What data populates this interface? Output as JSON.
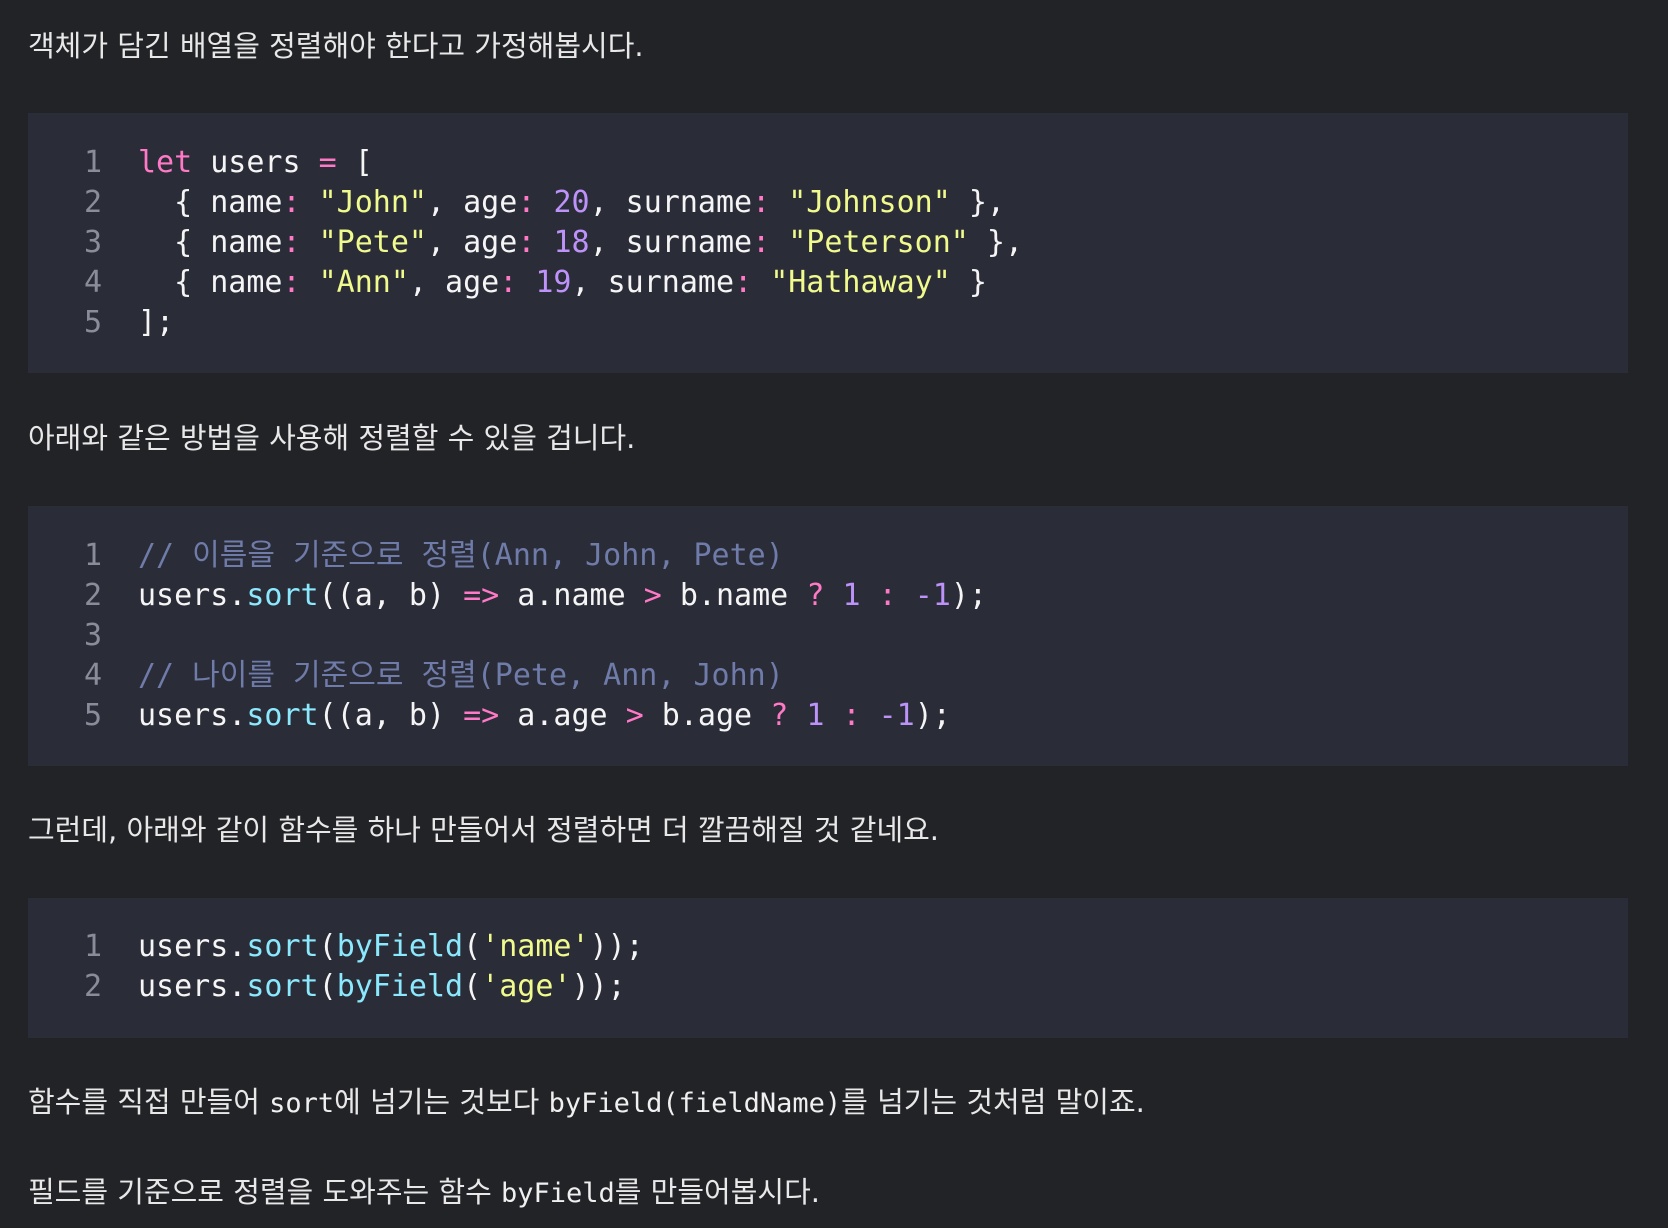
{
  "paragraphs": {
    "p1": "객체가 담긴 배열을 정렬해야 한다고 가정해봅시다.",
    "p2": "아래와 같은 방법을 사용해 정렬할 수 있을 겁니다.",
    "p3": "그런데, 아래와 같이 함수를 하나 만들어서 정렬하면 더 깔끔해질 것 같네요.",
    "p4_a": "함수를 직접 만들어 ",
    "p4_code1": "sort",
    "p4_b": "에 넘기는 것보다 ",
    "p4_code2": "byField(fieldName)",
    "p4_c": "를 넘기는 것처럼 말이죠.",
    "p5_a": "필드를 기준으로 정렬을 도와주는 함수 ",
    "p5_code": "byField",
    "p5_b": "를 만들어봅시다."
  },
  "code_blocks": [
    {
      "line_numbers": [
        "1",
        "2",
        "3",
        "4",
        "5"
      ],
      "lines": [
        [
          {
            "t": "let",
            "c": "kw"
          },
          {
            "t": " users ",
            "c": "pl"
          },
          {
            "t": "=",
            "c": "op"
          },
          {
            "t": " [",
            "c": "pl"
          }
        ],
        [
          {
            "t": "  { name",
            "c": "pl"
          },
          {
            "t": ":",
            "c": "op"
          },
          {
            "t": " ",
            "c": "pl"
          },
          {
            "t": "\"John\"",
            "c": "str"
          },
          {
            "t": ", age",
            "c": "pl"
          },
          {
            "t": ":",
            "c": "op"
          },
          {
            "t": " ",
            "c": "pl"
          },
          {
            "t": "20",
            "c": "num"
          },
          {
            "t": ", surname",
            "c": "pl"
          },
          {
            "t": ":",
            "c": "op"
          },
          {
            "t": " ",
            "c": "pl"
          },
          {
            "t": "\"Johnson\"",
            "c": "str"
          },
          {
            "t": " },",
            "c": "pl"
          }
        ],
        [
          {
            "t": "  { name",
            "c": "pl"
          },
          {
            "t": ":",
            "c": "op"
          },
          {
            "t": " ",
            "c": "pl"
          },
          {
            "t": "\"Pete\"",
            "c": "str"
          },
          {
            "t": ", age",
            "c": "pl"
          },
          {
            "t": ":",
            "c": "op"
          },
          {
            "t": " ",
            "c": "pl"
          },
          {
            "t": "18",
            "c": "num"
          },
          {
            "t": ", surname",
            "c": "pl"
          },
          {
            "t": ":",
            "c": "op"
          },
          {
            "t": " ",
            "c": "pl"
          },
          {
            "t": "\"Peterson\"",
            "c": "str"
          },
          {
            "t": " },",
            "c": "pl"
          }
        ],
        [
          {
            "t": "  { name",
            "c": "pl"
          },
          {
            "t": ":",
            "c": "op"
          },
          {
            "t": " ",
            "c": "pl"
          },
          {
            "t": "\"Ann\"",
            "c": "str"
          },
          {
            "t": ", age",
            "c": "pl"
          },
          {
            "t": ":",
            "c": "op"
          },
          {
            "t": " ",
            "c": "pl"
          },
          {
            "t": "19",
            "c": "num"
          },
          {
            "t": ", surname",
            "c": "pl"
          },
          {
            "t": ":",
            "c": "op"
          },
          {
            "t": " ",
            "c": "pl"
          },
          {
            "t": "\"Hathaway\"",
            "c": "str"
          },
          {
            "t": " }",
            "c": "pl"
          }
        ],
        [
          {
            "t": "];",
            "c": "pl"
          }
        ]
      ]
    },
    {
      "line_numbers": [
        "1",
        "2",
        "3",
        "4",
        "5"
      ],
      "lines": [
        [
          {
            "t": "// 이름을 기준으로 정렬(Ann, John, Pete)",
            "c": "cm"
          }
        ],
        [
          {
            "t": "users.",
            "c": "pl"
          },
          {
            "t": "sort",
            "c": "fn"
          },
          {
            "t": "((a, b) ",
            "c": "pl"
          },
          {
            "t": "=>",
            "c": "op"
          },
          {
            "t": " a.name ",
            "c": "pl"
          },
          {
            "t": ">",
            "c": "op"
          },
          {
            "t": " b.name ",
            "c": "pl"
          },
          {
            "t": "?",
            "c": "op"
          },
          {
            "t": " ",
            "c": "pl"
          },
          {
            "t": "1",
            "c": "num"
          },
          {
            "t": " ",
            "c": "pl"
          },
          {
            "t": ":",
            "c": "op"
          },
          {
            "t": " ",
            "c": "pl"
          },
          {
            "t": "-1",
            "c": "num"
          },
          {
            "t": ");",
            "c": "pl"
          }
        ],
        [
          {
            "t": "",
            "c": "pl"
          }
        ],
        [
          {
            "t": "// 나이를 기준으로 정렬(Pete, Ann, John)",
            "c": "cm"
          }
        ],
        [
          {
            "t": "users.",
            "c": "pl"
          },
          {
            "t": "sort",
            "c": "fn"
          },
          {
            "t": "((a, b) ",
            "c": "pl"
          },
          {
            "t": "=>",
            "c": "op"
          },
          {
            "t": " a.age ",
            "c": "pl"
          },
          {
            "t": ">",
            "c": "op"
          },
          {
            "t": " b.age ",
            "c": "pl"
          },
          {
            "t": "?",
            "c": "op"
          },
          {
            "t": " ",
            "c": "pl"
          },
          {
            "t": "1",
            "c": "num"
          },
          {
            "t": " ",
            "c": "pl"
          },
          {
            "t": ":",
            "c": "op"
          },
          {
            "t": " ",
            "c": "pl"
          },
          {
            "t": "-1",
            "c": "num"
          },
          {
            "t": ");",
            "c": "pl"
          }
        ]
      ]
    },
    {
      "line_numbers": [
        "1",
        "2"
      ],
      "lines": [
        [
          {
            "t": "users.",
            "c": "pl"
          },
          {
            "t": "sort",
            "c": "fn"
          },
          {
            "t": "(",
            "c": "pl"
          },
          {
            "t": "byField",
            "c": "fn"
          },
          {
            "t": "(",
            "c": "pl"
          },
          {
            "t": "'name'",
            "c": "str"
          },
          {
            "t": "));",
            "c": "pl"
          }
        ],
        [
          {
            "t": "users.",
            "c": "pl"
          },
          {
            "t": "sort",
            "c": "fn"
          },
          {
            "t": "(",
            "c": "pl"
          },
          {
            "t": "byField",
            "c": "fn"
          },
          {
            "t": "(",
            "c": "pl"
          },
          {
            "t": "'age'",
            "c": "str"
          },
          {
            "t": "));",
            "c": "pl"
          }
        ]
      ]
    }
  ],
  "colors": {
    "background": "#222327",
    "code_background": "#2a2c38",
    "keyword": "#ff79c6",
    "string": "#f1fa8c",
    "number": "#bd93f9",
    "function": "#8be9fd",
    "comment": "#6f7ba8"
  }
}
